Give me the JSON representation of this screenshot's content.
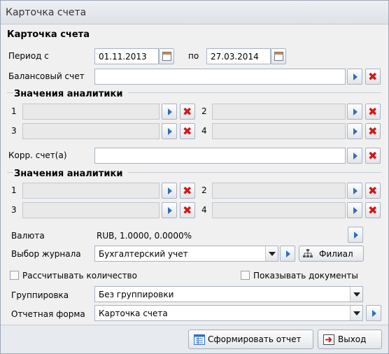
{
  "window": {
    "title": "Карточка счета"
  },
  "form": {
    "heading": "Карточка счета"
  },
  "period": {
    "from_label": "Период с",
    "from_value": "01.11.2013",
    "to_label": "по",
    "to_value": "27.03.2014"
  },
  "balance_account": {
    "label": "Балансовый счет",
    "value": ""
  },
  "analytics1": {
    "heading": "Значения аналитики",
    "n1": "1",
    "n2": "2",
    "n3": "3",
    "n4": "4"
  },
  "corr_account": {
    "label": "Корр. счет(а)",
    "value": ""
  },
  "analytics2": {
    "heading": "Значения аналитики",
    "n1": "1",
    "n2": "2",
    "n3": "3",
    "n4": "4"
  },
  "currency": {
    "label": "Валюта",
    "value": "RUB, 1.0000, 0.0000%"
  },
  "journal": {
    "label": "Выбор журнала",
    "value": "Бухгалтерский учет",
    "branch_button": "Филиал"
  },
  "options": {
    "count_label": "Рассчитывать количество",
    "count_checked": false,
    "docs_label": "Показывать документы",
    "docs_checked": false
  },
  "grouping": {
    "label": "Группировка",
    "value": "Без группировки"
  },
  "report_form": {
    "label": "Отчетная форма",
    "value": "Карточка счета"
  },
  "footer": {
    "generate_button": "Сформировать отчет",
    "exit_button": "Выход"
  }
}
